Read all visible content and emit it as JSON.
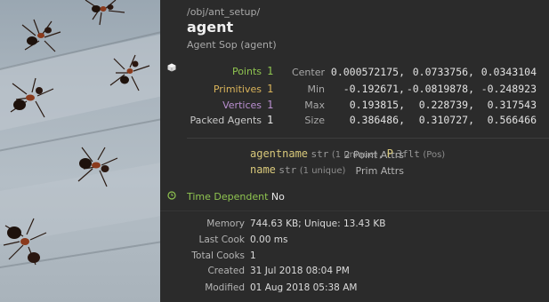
{
  "node": {
    "path": "/obj/ant_setup/",
    "name": "agent",
    "type_label": "Agent Sop (agent)"
  },
  "geometry": {
    "counts": [
      {
        "label": "Points",
        "value": "1",
        "color": "#8fc450"
      },
      {
        "label": "Primitives",
        "value": "1",
        "color": "#d9b35a"
      },
      {
        "label": "Vertices",
        "value": "1",
        "color": "#b98fd0"
      },
      {
        "label": "Packed Agents",
        "value": "1",
        "color": "#c8c8c8"
      }
    ],
    "bounds": [
      {
        "label": "Center",
        "values": [
          "0.000572175,",
          "0.0733756,",
          "0.0343104"
        ]
      },
      {
        "label": "Min",
        "values": [
          "-0.192671,",
          "-0.0819878,",
          "-0.248923"
        ]
      },
      {
        "label": "Max",
        "values": [
          "0.193815,",
          "0.228739,",
          "0.317543"
        ]
      },
      {
        "label": "Size",
        "values": [
          "0.386486,",
          "0.310727,",
          "0.566466"
        ]
      }
    ]
  },
  "attributes": {
    "point": {
      "label": "2 Point Attrs",
      "items": [
        {
          "name": "agentname",
          "type": "str",
          "note": "(1 unique)",
          "sep": ","
        },
        {
          "name": "P",
          "type": "3flt",
          "note": "(Pos)",
          "sep": ""
        }
      ]
    },
    "prim": {
      "label": "Prim Attrs",
      "items": [
        {
          "name": "name",
          "type": "str",
          "note": "(1 unique)",
          "sep": ""
        }
      ]
    }
  },
  "time_dependent": {
    "label": "Time Dependent",
    "value": "No"
  },
  "stats": [
    {
      "label": "Memory",
      "value": "744.63 KB; Unique: 13.43 KB"
    },
    {
      "label": "Last Cook",
      "value": "0.00 ms"
    },
    {
      "label": "Total Cooks",
      "value": "1"
    },
    {
      "label": "Created",
      "value": "31 Jul 2018 08:04 PM"
    },
    {
      "label": "Modified",
      "value": "01 Aug 2018 05:38 AM"
    }
  ],
  "icons": {
    "geometry": "geometry-cube-icon",
    "time": "clock-icon"
  },
  "colors": {
    "panel_bg": "#2b2b2b",
    "attr_name": "#d8c87a",
    "time_icon": "#8fc450"
  }
}
